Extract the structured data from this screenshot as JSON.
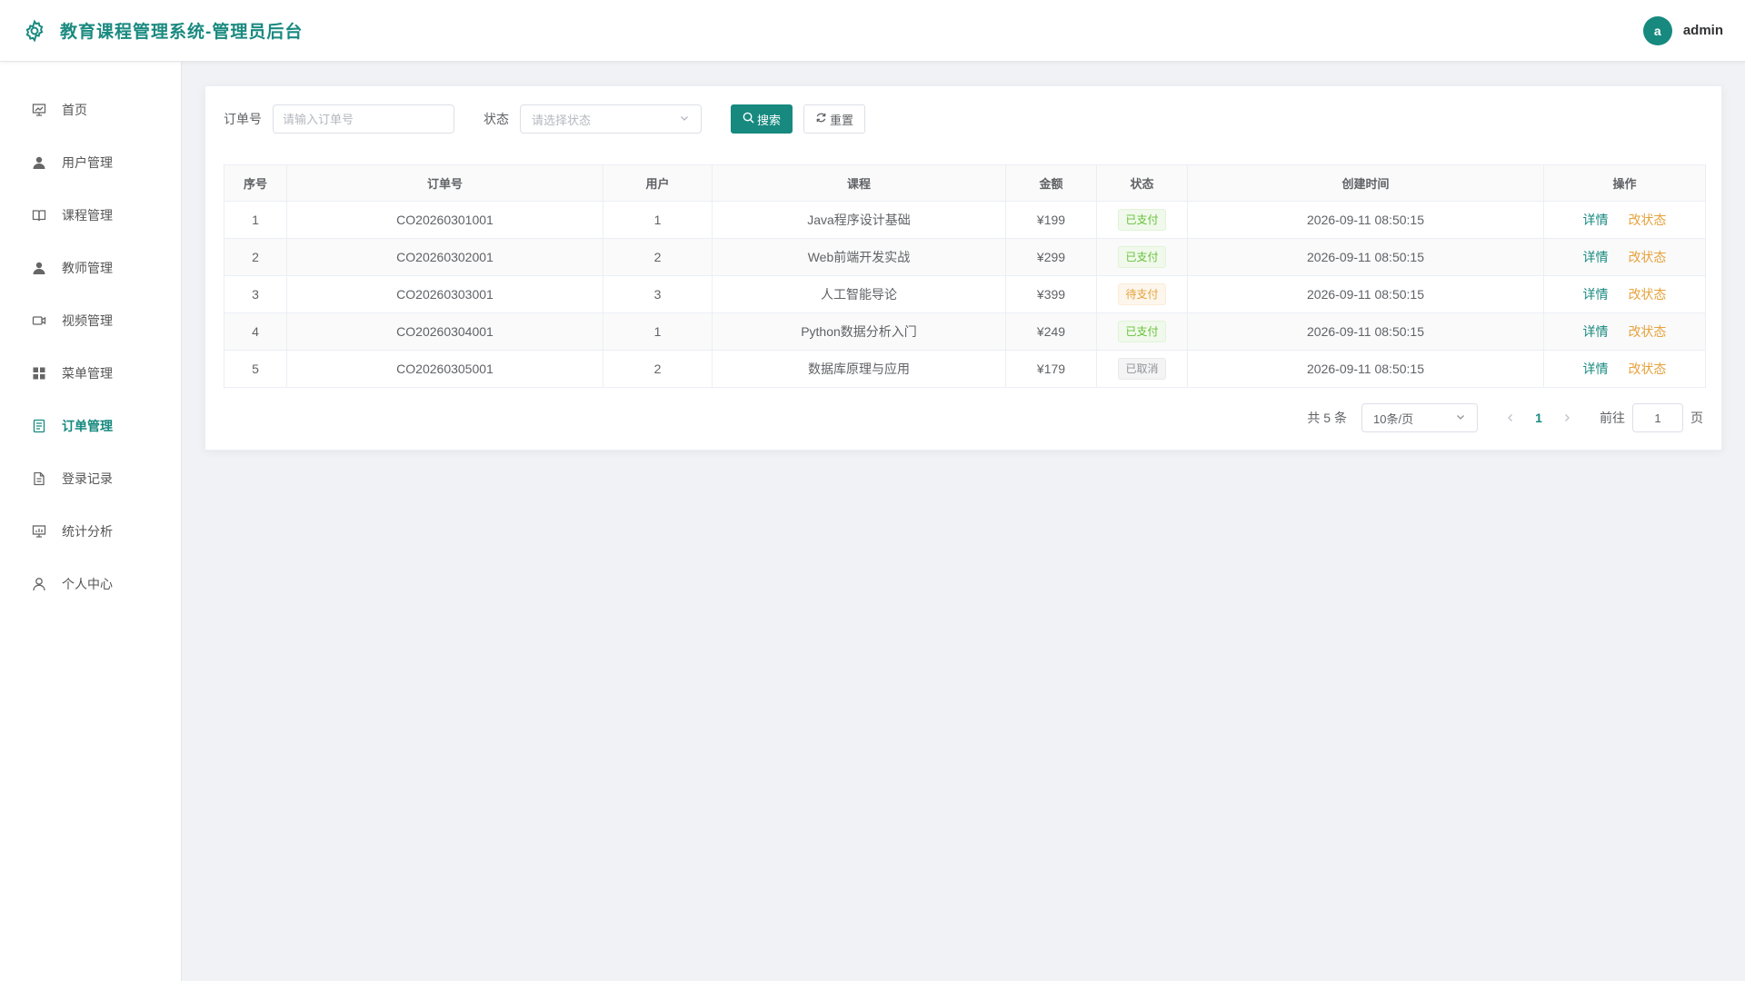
{
  "header": {
    "title": "教育课程管理系统-管理员后台",
    "avatar_letter": "a",
    "username": "admin",
    "accent": "#17897f"
  },
  "sidebar": {
    "items": [
      {
        "label": "首页",
        "icon": "dashboard-icon"
      },
      {
        "label": "用户管理",
        "icon": "user-icon"
      },
      {
        "label": "课程管理",
        "icon": "book-icon"
      },
      {
        "label": "教师管理",
        "icon": "teacher-icon"
      },
      {
        "label": "视频管理",
        "icon": "video-icon"
      },
      {
        "label": "菜单管理",
        "icon": "grid-icon"
      },
      {
        "label": "订单管理",
        "icon": "document-icon",
        "active": true
      },
      {
        "label": "登录记录",
        "icon": "file-icon"
      },
      {
        "label": "统计分析",
        "icon": "chart-board-icon"
      },
      {
        "label": "个人中心",
        "icon": "person-icon"
      }
    ]
  },
  "search": {
    "order_label": "订单号",
    "order_placeholder": "请输入订单号",
    "status_label": "状态",
    "status_placeholder": "请选择状态",
    "search_button": "搜索",
    "reset_button": "重置"
  },
  "table": {
    "columns": [
      "序号",
      "订单号",
      "用户",
      "课程",
      "金额",
      "状态",
      "创建时间",
      "操作"
    ],
    "rows": [
      {
        "index": "1",
        "order_no": "CO20260301001",
        "user": "1",
        "course": "Java程序设计基础",
        "amount": "¥199",
        "status": "已支付",
        "status_type": "success",
        "created": "2026-09-11 08:50:15"
      },
      {
        "index": "2",
        "order_no": "CO20260302001",
        "user": "2",
        "course": "Web前端开发实战",
        "amount": "¥299",
        "status": "已支付",
        "status_type": "success",
        "created": "2026-09-11 08:50:15"
      },
      {
        "index": "3",
        "order_no": "CO20260303001",
        "user": "3",
        "course": "人工智能导论",
        "amount": "¥399",
        "status": "待支付",
        "status_type": "warning",
        "created": "2026-09-11 08:50:15"
      },
      {
        "index": "4",
        "order_no": "CO20260304001",
        "user": "1",
        "course": "Python数据分析入门",
        "amount": "¥249",
        "status": "已支付",
        "status_type": "success",
        "created": "2026-09-11 08:50:15"
      },
      {
        "index": "5",
        "order_no": "CO20260305001",
        "user": "2",
        "course": "数据库原理与应用",
        "amount": "¥179",
        "status": "已取消",
        "status_type": "info",
        "created": "2026-09-11 08:50:15"
      }
    ],
    "detail_label": "详情",
    "change_status_label": "改状态"
  },
  "pagination": {
    "total_text": "共 5 条",
    "page_size": "10条/页",
    "current_page": "1",
    "goto_label": "前往",
    "goto_value": "1",
    "page_suffix": "页"
  }
}
